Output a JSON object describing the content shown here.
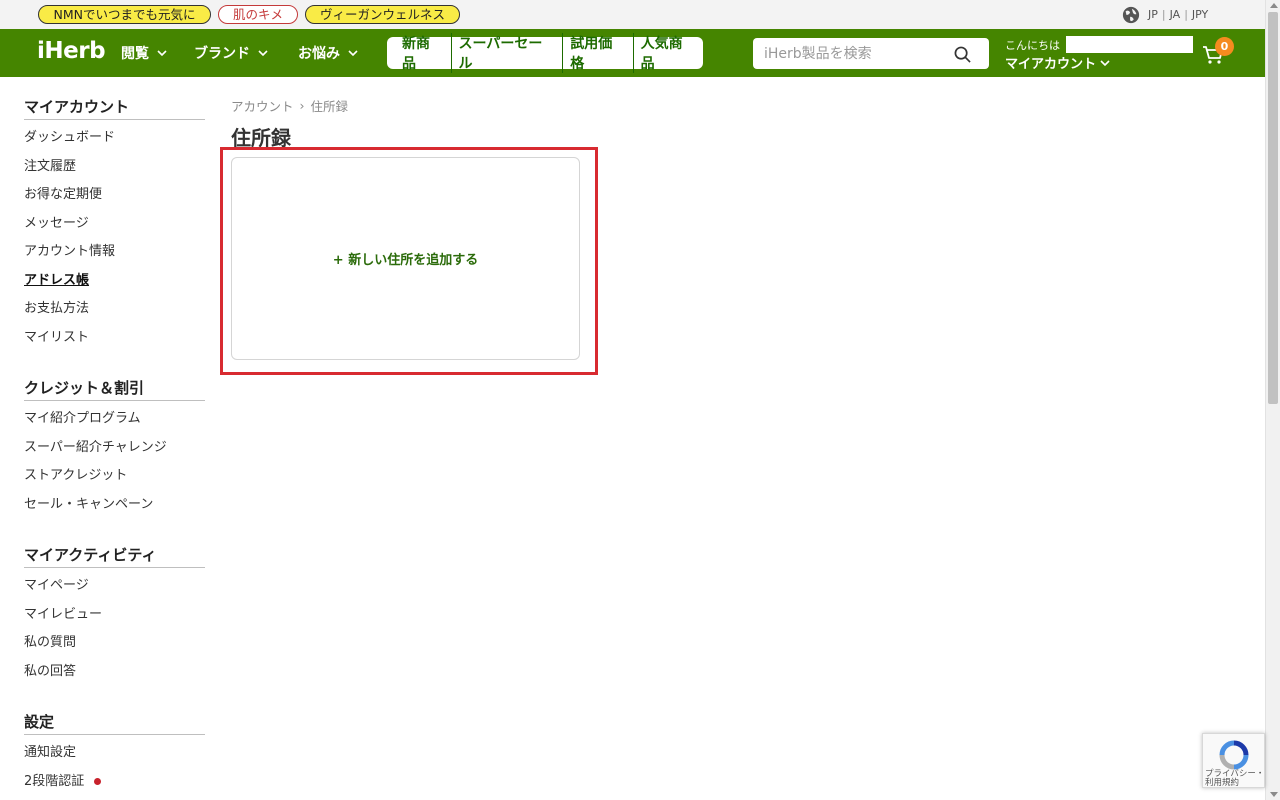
{
  "topbar": {
    "promos": [
      "NMNでいつまでも元気に",
      "肌のキメ",
      "ヴィーガンウェルネス"
    ],
    "locale": {
      "country": "JP",
      "language": "JA",
      "currency": "JPY"
    }
  },
  "header": {
    "logo": "iHerb",
    "nav": [
      "閲覧",
      "ブランド",
      "お悩み"
    ],
    "promo_links": [
      "新商品",
      "スーパーセール",
      "試用価格",
      "人気商品"
    ],
    "search_placeholder": "iHerb製品を検索",
    "greeting": "こんにちは",
    "account_label": "マイアカウント",
    "cart_count": "0"
  },
  "sidebar": {
    "sections": [
      {
        "title": "マイアカウント",
        "items": [
          "ダッシュボード",
          "注文履歴",
          "お得な定期便",
          "メッセージ",
          "アカウント情報",
          "アドレス帳",
          "お支払方法",
          "マイリスト"
        ]
      },
      {
        "title": "クレジット＆割引",
        "items": [
          "マイ紹介プログラム",
          "スーパー紹介チャレンジ",
          "ストアクレジット",
          "セール・キャンペーン"
        ]
      },
      {
        "title": "マイアクティビティ",
        "items": [
          "マイページ",
          "マイレビュー",
          "私の質問",
          "私の回答"
        ]
      },
      {
        "title": "設定",
        "items": [
          "通知設定",
          "2段階認証"
        ]
      }
    ],
    "active_item": "アドレス帳"
  },
  "main": {
    "breadcrumb": [
      "アカウント",
      "住所録"
    ],
    "title": "住所録",
    "add_address": "+ 新しい住所を追加する"
  },
  "recaptcha": {
    "line1": "プライバシー・",
    "line2": "利用規約"
  },
  "colors": {
    "brand_green": "#458500",
    "link_green": "#2b6b0a",
    "highlight_red": "#d82a31",
    "badge_orange": "#f58b1f",
    "promo_yellow": "#f9eb46"
  }
}
